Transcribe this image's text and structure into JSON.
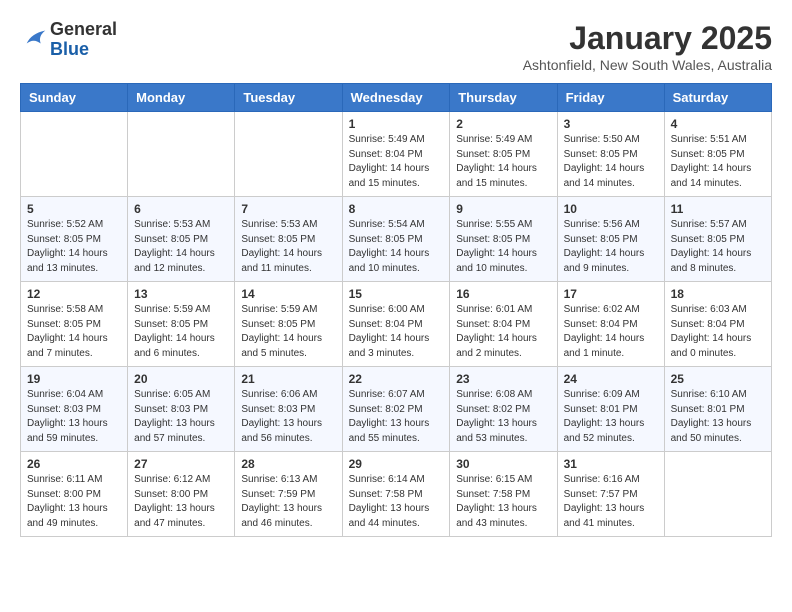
{
  "header": {
    "logo": {
      "line1": "General",
      "line2": "Blue"
    },
    "title": "January 2025",
    "location": "Ashtonfield, New South Wales, Australia"
  },
  "weekdays": [
    "Sunday",
    "Monday",
    "Tuesday",
    "Wednesday",
    "Thursday",
    "Friday",
    "Saturday"
  ],
  "weeks": [
    [
      {
        "day": "",
        "info": ""
      },
      {
        "day": "",
        "info": ""
      },
      {
        "day": "",
        "info": ""
      },
      {
        "day": "1",
        "info": "Sunrise: 5:49 AM\nSunset: 8:04 PM\nDaylight: 14 hours\nand 15 minutes."
      },
      {
        "day": "2",
        "info": "Sunrise: 5:49 AM\nSunset: 8:05 PM\nDaylight: 14 hours\nand 15 minutes."
      },
      {
        "day": "3",
        "info": "Sunrise: 5:50 AM\nSunset: 8:05 PM\nDaylight: 14 hours\nand 14 minutes."
      },
      {
        "day": "4",
        "info": "Sunrise: 5:51 AM\nSunset: 8:05 PM\nDaylight: 14 hours\nand 14 minutes."
      }
    ],
    [
      {
        "day": "5",
        "info": "Sunrise: 5:52 AM\nSunset: 8:05 PM\nDaylight: 14 hours\nand 13 minutes."
      },
      {
        "day": "6",
        "info": "Sunrise: 5:53 AM\nSunset: 8:05 PM\nDaylight: 14 hours\nand 12 minutes."
      },
      {
        "day": "7",
        "info": "Sunrise: 5:53 AM\nSunset: 8:05 PM\nDaylight: 14 hours\nand 11 minutes."
      },
      {
        "day": "8",
        "info": "Sunrise: 5:54 AM\nSunset: 8:05 PM\nDaylight: 14 hours\nand 10 minutes."
      },
      {
        "day": "9",
        "info": "Sunrise: 5:55 AM\nSunset: 8:05 PM\nDaylight: 14 hours\nand 10 minutes."
      },
      {
        "day": "10",
        "info": "Sunrise: 5:56 AM\nSunset: 8:05 PM\nDaylight: 14 hours\nand 9 minutes."
      },
      {
        "day": "11",
        "info": "Sunrise: 5:57 AM\nSunset: 8:05 PM\nDaylight: 14 hours\nand 8 minutes."
      }
    ],
    [
      {
        "day": "12",
        "info": "Sunrise: 5:58 AM\nSunset: 8:05 PM\nDaylight: 14 hours\nand 7 minutes."
      },
      {
        "day": "13",
        "info": "Sunrise: 5:59 AM\nSunset: 8:05 PM\nDaylight: 14 hours\nand 6 minutes."
      },
      {
        "day": "14",
        "info": "Sunrise: 5:59 AM\nSunset: 8:05 PM\nDaylight: 14 hours\nand 5 minutes."
      },
      {
        "day": "15",
        "info": "Sunrise: 6:00 AM\nSunset: 8:04 PM\nDaylight: 14 hours\nand 3 minutes."
      },
      {
        "day": "16",
        "info": "Sunrise: 6:01 AM\nSunset: 8:04 PM\nDaylight: 14 hours\nand 2 minutes."
      },
      {
        "day": "17",
        "info": "Sunrise: 6:02 AM\nSunset: 8:04 PM\nDaylight: 14 hours\nand 1 minute."
      },
      {
        "day": "18",
        "info": "Sunrise: 6:03 AM\nSunset: 8:04 PM\nDaylight: 14 hours\nand 0 minutes."
      }
    ],
    [
      {
        "day": "19",
        "info": "Sunrise: 6:04 AM\nSunset: 8:03 PM\nDaylight: 13 hours\nand 59 minutes."
      },
      {
        "day": "20",
        "info": "Sunrise: 6:05 AM\nSunset: 8:03 PM\nDaylight: 13 hours\nand 57 minutes."
      },
      {
        "day": "21",
        "info": "Sunrise: 6:06 AM\nSunset: 8:03 PM\nDaylight: 13 hours\nand 56 minutes."
      },
      {
        "day": "22",
        "info": "Sunrise: 6:07 AM\nSunset: 8:02 PM\nDaylight: 13 hours\nand 55 minutes."
      },
      {
        "day": "23",
        "info": "Sunrise: 6:08 AM\nSunset: 8:02 PM\nDaylight: 13 hours\nand 53 minutes."
      },
      {
        "day": "24",
        "info": "Sunrise: 6:09 AM\nSunset: 8:01 PM\nDaylight: 13 hours\nand 52 minutes."
      },
      {
        "day": "25",
        "info": "Sunrise: 6:10 AM\nSunset: 8:01 PM\nDaylight: 13 hours\nand 50 minutes."
      }
    ],
    [
      {
        "day": "26",
        "info": "Sunrise: 6:11 AM\nSunset: 8:00 PM\nDaylight: 13 hours\nand 49 minutes."
      },
      {
        "day": "27",
        "info": "Sunrise: 6:12 AM\nSunset: 8:00 PM\nDaylight: 13 hours\nand 47 minutes."
      },
      {
        "day": "28",
        "info": "Sunrise: 6:13 AM\nSunset: 7:59 PM\nDaylight: 13 hours\nand 46 minutes."
      },
      {
        "day": "29",
        "info": "Sunrise: 6:14 AM\nSunset: 7:58 PM\nDaylight: 13 hours\nand 44 minutes."
      },
      {
        "day": "30",
        "info": "Sunrise: 6:15 AM\nSunset: 7:58 PM\nDaylight: 13 hours\nand 43 minutes."
      },
      {
        "day": "31",
        "info": "Sunrise: 6:16 AM\nSunset: 7:57 PM\nDaylight: 13 hours\nand 41 minutes."
      },
      {
        "day": "",
        "info": ""
      }
    ]
  ]
}
